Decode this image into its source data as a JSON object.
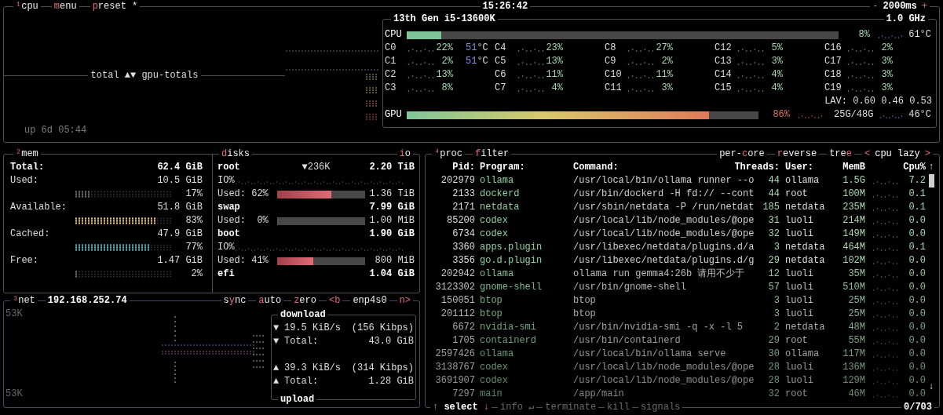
{
  "cpu_panel": {
    "tabs": [
      {
        "key": "¹",
        "after": "cpu"
      },
      {
        "key": "m",
        "after": "enu"
      },
      {
        "key": "p",
        "after": "reset *"
      }
    ],
    "clock": "15:26:42",
    "interval": {
      "minus": "-",
      "value": "2000ms",
      "plus": "+"
    },
    "graph_label": "total ▲▼ gpu-totals",
    "uptime": "up 6d 05:44",
    "cpu_box": {
      "model": "13th Gen i5-13600K",
      "freq": "1.0 GHz",
      "cpu_label": "CPU",
      "cpu_bar": {
        "level": 0.08
      },
      "cpu_pct": "8%",
      "cpu_temp": "61°C",
      "cores": [
        {
          "name": "C0",
          "pct": "22%",
          "temp": "51",
          "temp_unit": "°C"
        },
        {
          "name": "C1",
          "pct": "2%",
          "temp": "51",
          "temp_unit": "°C"
        },
        {
          "name": "C2",
          "pct": "13%"
        },
        {
          "name": "C3",
          "pct": "8%"
        },
        {
          "name": "C4",
          "pct": "23%"
        },
        {
          "name": "C5",
          "pct": "13%"
        },
        {
          "name": "C6",
          "pct": "11%"
        },
        {
          "name": "C7",
          "pct": "4%"
        },
        {
          "name": "C8",
          "pct": "27%"
        },
        {
          "name": "C9",
          "pct": "2%"
        },
        {
          "name": "C10",
          "pct": "11%"
        },
        {
          "name": "C11",
          "pct": "3%"
        },
        {
          "name": "C12",
          "pct": "5%"
        },
        {
          "name": "C13",
          "pct": "3%"
        },
        {
          "name": "C14",
          "pct": "4%"
        },
        {
          "name": "C15",
          "pct": "4%"
        },
        {
          "name": "C16",
          "pct": "2%"
        },
        {
          "name": "C17",
          "pct": "3%"
        },
        {
          "name": "C18",
          "pct": "3%"
        },
        {
          "name": "C19",
          "pct": "3%"
        }
      ],
      "load_avg": "LAV: 0.60 0.46 0.53",
      "gpu_label": "GPU",
      "gpu_bar": {
        "level": 0.86
      },
      "gpu_pct": "86%",
      "gpu_mem": "25G/48G",
      "gpu_temp": "46°C"
    }
  },
  "mem_panel": {
    "tab": {
      "key": "²",
      "after": "mem"
    },
    "rows": [
      {
        "kind": "total",
        "label": "Total:",
        "value": "62.4 GiB"
      },
      {
        "kind": "meter",
        "label": "Used:",
        "value": "10.5 GiB",
        "pct": "17%",
        "level": 0.17,
        "color": "#6e6e6e"
      },
      {
        "kind": "meter",
        "label": "Available:",
        "value": "51.8 GiB",
        "pct": "83%",
        "level": 0.83,
        "color": "#e5c07b"
      },
      {
        "kind": "meter",
        "label": "Cached:",
        "value": "47.9 GiB",
        "pct": "77%",
        "level": 0.77,
        "color": "#56b6c2"
      },
      {
        "kind": "meter",
        "label": "Free:",
        "value": "1.47 GiB",
        "pct": "2%",
        "level": 0.02,
        "color": "#6e6e6e"
      }
    ]
  },
  "disks_panel": {
    "tab": {
      "key": "d",
      "after": "isks"
    },
    "io_tab": {
      "key": "i",
      "after": "o"
    },
    "disks": [
      {
        "name": "root",
        "io": "▼236K",
        "size": "2.20 TiB",
        "io_label": "IO%",
        "used_label": "Used: 62%",
        "level": 0.62,
        "used": "1.36 TiB"
      },
      {
        "name": "swap",
        "size": "7.99 GiB",
        "used_label": "Used:  0%",
        "level": 0,
        "used": "1.00 MiB"
      },
      {
        "name": "boot",
        "size": "1.90 GiB",
        "io_label": "IO%",
        "used_label": "Used: 41%",
        "level": 0.41,
        "used": "800 MiB"
      },
      {
        "name": "efi",
        "size": "1.04 GiB"
      }
    ]
  },
  "net_panel": {
    "tab": {
      "key": "³",
      "after": "net"
    },
    "ip": "192.168.252.74",
    "controls": [
      {
        "before": "s",
        "key": "y",
        "after": "nc"
      },
      {
        "key": "a",
        "after": "uto"
      },
      {
        "key": "z",
        "after": "ero"
      },
      {
        "key": "<b"
      },
      {
        "before": "enp4s0"
      },
      {
        "key": "n>"
      }
    ],
    "scale_top": "53K",
    "scale_bottom": "53K",
    "download_title": "download",
    "upload_title": "upload",
    "lines": [
      {
        "icon": "▼",
        "label": "19.5 KiB/s",
        "value": "(156 Kibps)"
      },
      {
        "icon": "▼",
        "label": "Total:",
        "value": "43.0 GiB"
      },
      {
        "icon": "▲",
        "label": "39.3 KiB/s",
        "value": "(314 Kibps)"
      },
      {
        "icon": "▲",
        "label": "Total:",
        "value": "1.28 GiB"
      }
    ]
  },
  "proc_panel": {
    "tab": {
      "key": "⁴",
      "after": "proc"
    },
    "filter": {
      "key": "f",
      "after": "ilter"
    },
    "options": [
      {
        "before": "per-",
        "key": "c",
        "after": "ore"
      },
      {
        "key": "r",
        "after": "everse"
      },
      {
        "before": "tre",
        "key": "e"
      }
    ],
    "sort": {
      "prev": "<",
      "label": "cpu lazy",
      "next": ">"
    },
    "columns": [
      "Pid:",
      "Program:",
      "Command:",
      "Threads:",
      "User:",
      "MemB",
      "Cpu%"
    ],
    "rows": [
      {
        "pid": "202979",
        "program": "ollama",
        "command": "/usr/local/bin/ollama runner --o",
        "threads": "44",
        "user": "ollama",
        "mem": "1.5G",
        "cpu": "7.2"
      },
      {
        "pid": "2133",
        "program": "dockerd",
        "command": "/usr/bin/dockerd -H fd:// --cont",
        "threads": "44",
        "user": "root",
        "mem": "100M",
        "cpu": "0.1"
      },
      {
        "pid": "2171",
        "program": "netdata",
        "command": "/usr/sbin/netdata -P /run/netdat",
        "threads": "185",
        "user": "netdata",
        "mem": "235M",
        "cpu": "0.1"
      },
      {
        "pid": "85200",
        "program": "codex",
        "command": "/usr/local/lib/node_modules/@ope",
        "threads": "31",
        "user": "luoli",
        "mem": "214M",
        "cpu": "0.0"
      },
      {
        "pid": "6734",
        "program": "codex",
        "command": "/usr/local/lib/node_modules/@ope",
        "threads": "32",
        "user": "luoli",
        "mem": "149M",
        "cpu": "0.0"
      },
      {
        "pid": "3360",
        "program": "apps.plugin",
        "command": "/usr/libexec/netdata/plugins.d/a",
        "threads": "3",
        "user": "netdata",
        "mem": "464M",
        "cpu": "0.1"
      },
      {
        "pid": "3356",
        "program": "go.d.plugin",
        "command": "/usr/libexec/netdata/plugins.d/g",
        "threads": "29",
        "user": "netdata",
        "mem": "102M",
        "cpu": "0.0"
      },
      {
        "pid": "202942",
        "program": "ollama",
        "command": "ollama run gemma4:26b 请用不少于",
        "threads": "12",
        "user": "luoli",
        "mem": "35M",
        "cpu": "0.0"
      },
      {
        "pid": "3123302",
        "program": "gnome-shell",
        "command": "/usr/bin/gnome-shell",
        "threads": "57",
        "user": "luoli",
        "mem": "510M",
        "cpu": "0.0"
      },
      {
        "pid": "150051",
        "program": "btop",
        "command": "btop",
        "threads": "3",
        "user": "luoli",
        "mem": "25M",
        "cpu": "0.0"
      },
      {
        "pid": "201112",
        "program": "btop",
        "command": "btop",
        "threads": "3",
        "user": "luoli",
        "mem": "25M",
        "cpu": "0.0"
      },
      {
        "pid": "6672",
        "program": "nvidia-smi",
        "command": "/usr/bin/nvidia-smi -q -x -l 5",
        "threads": "2",
        "user": "netdata",
        "mem": "48M",
        "cpu": "0.0"
      },
      {
        "pid": "1705",
        "program": "containerd",
        "command": "/usr/bin/containerd",
        "threads": "29",
        "user": "root",
        "mem": "55M",
        "cpu": "0.0"
      },
      {
        "pid": "2597426",
        "program": "ollama",
        "command": "/usr/local/bin/ollama serve",
        "threads": "30",
        "user": "ollama",
        "mem": "117M",
        "cpu": "0.0"
      },
      {
        "pid": "3138767",
        "program": "codex",
        "command": "/usr/local/lib/node_modules/@ope",
        "threads": "28",
        "user": "luoli",
        "mem": "136M",
        "cpu": "0.0"
      },
      {
        "pid": "3691907",
        "program": "codex",
        "command": "/usr/local/lib/node_modules/@ope",
        "threads": "28",
        "user": "luoli",
        "mem": "129M",
        "cpu": "0.0"
      },
      {
        "pid": "7297",
        "program": "main",
        "command": "/app/main",
        "threads": "32",
        "user": "root",
        "mem": "46M",
        "cpu": "0.0"
      }
    ],
    "scroll_up": "↑",
    "scroll_down": "↓",
    "footer": {
      "up": "↑",
      "select": "select",
      "down": "↓",
      "actions": [
        {
          "label": "info",
          "key": "↵",
          "disabled": true
        },
        {
          "label": "terminate",
          "disabled": true
        },
        {
          "label": "kill",
          "disabled": true
        },
        {
          "label": "signals",
          "disabled": true
        }
      ],
      "count": "0/703"
    }
  }
}
